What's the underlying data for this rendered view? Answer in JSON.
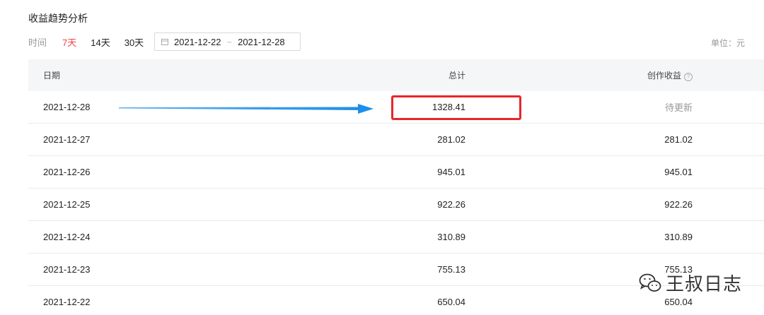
{
  "section_title": "收益趋势分析",
  "filter": {
    "label": "时间",
    "ranges": [
      "7天",
      "14天",
      "30天"
    ],
    "active_range": "7天",
    "date_start": "2021-12-22",
    "date_separator": "~",
    "date_end": "2021-12-28"
  },
  "unit_label": "单位：元",
  "table": {
    "headers": {
      "date": "日期",
      "total": "总计",
      "creation": "创作收益"
    },
    "rows": [
      {
        "date": "2021-12-28",
        "total": "1328.41",
        "creation": "待更新"
      },
      {
        "date": "2021-12-27",
        "total": "281.02",
        "creation": "281.02"
      },
      {
        "date": "2021-12-26",
        "total": "945.01",
        "creation": "945.01"
      },
      {
        "date": "2021-12-25",
        "total": "922.26",
        "creation": "922.26"
      },
      {
        "date": "2021-12-24",
        "total": "310.89",
        "creation": "310.89"
      },
      {
        "date": "2021-12-23",
        "total": "755.13",
        "creation": "755.13"
      },
      {
        "date": "2021-12-22",
        "total": "650.04",
        "creation": "650.04"
      }
    ]
  },
  "annotation": {
    "arrow_color": "#1e8fe8",
    "box_color": "#e8262a"
  },
  "watermark": {
    "text": "王叔日志",
    "icon": "wechat-icon"
  },
  "icons": {
    "calendar": "calendar-icon",
    "help": "help-circle-icon"
  }
}
